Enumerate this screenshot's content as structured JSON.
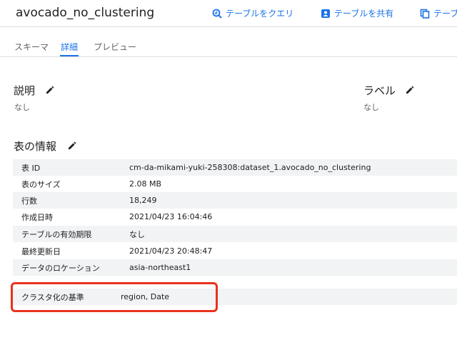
{
  "header": {
    "title": "avocado_no_clustering",
    "actions": [
      {
        "label": "テーブルをクエリ",
        "icon": "query-icon"
      },
      {
        "label": "テーブルを共有",
        "icon": "share-icon"
      },
      {
        "label": "テーブ",
        "icon": "copy-icon"
      }
    ]
  },
  "tabs": [
    {
      "label": "スキーマ",
      "active": false
    },
    {
      "label": "詳細",
      "active": true
    },
    {
      "label": "プレビュー",
      "active": false
    }
  ],
  "description": {
    "title": "説明",
    "value": "なし"
  },
  "labels": {
    "title": "ラベル",
    "value": "なし"
  },
  "table_info": {
    "title": "表の情報",
    "rows": [
      {
        "key": "表 ID",
        "value": "cm-da-mikami-yuki-258308:dataset_1.avocado_no_clustering"
      },
      {
        "key": "表のサイズ",
        "value": "2.08 MB"
      },
      {
        "key": "行数",
        "value": "18,249"
      },
      {
        "key": "作成日時",
        "value": "2021/04/23 16:04:46"
      },
      {
        "key": "テーブルの有効期限",
        "value": "なし"
      },
      {
        "key": "最終更新日",
        "value": "2021/04/23 20:48:47"
      },
      {
        "key": "データのロケーション",
        "value": "asia-northeast1"
      }
    ],
    "clustering": {
      "key": "クラスタ化の基準",
      "value": "region, Date"
    }
  },
  "colors": {
    "accent": "#1a73e8",
    "highlight": "#e8321d",
    "row_shade": "#f1f3f4"
  }
}
